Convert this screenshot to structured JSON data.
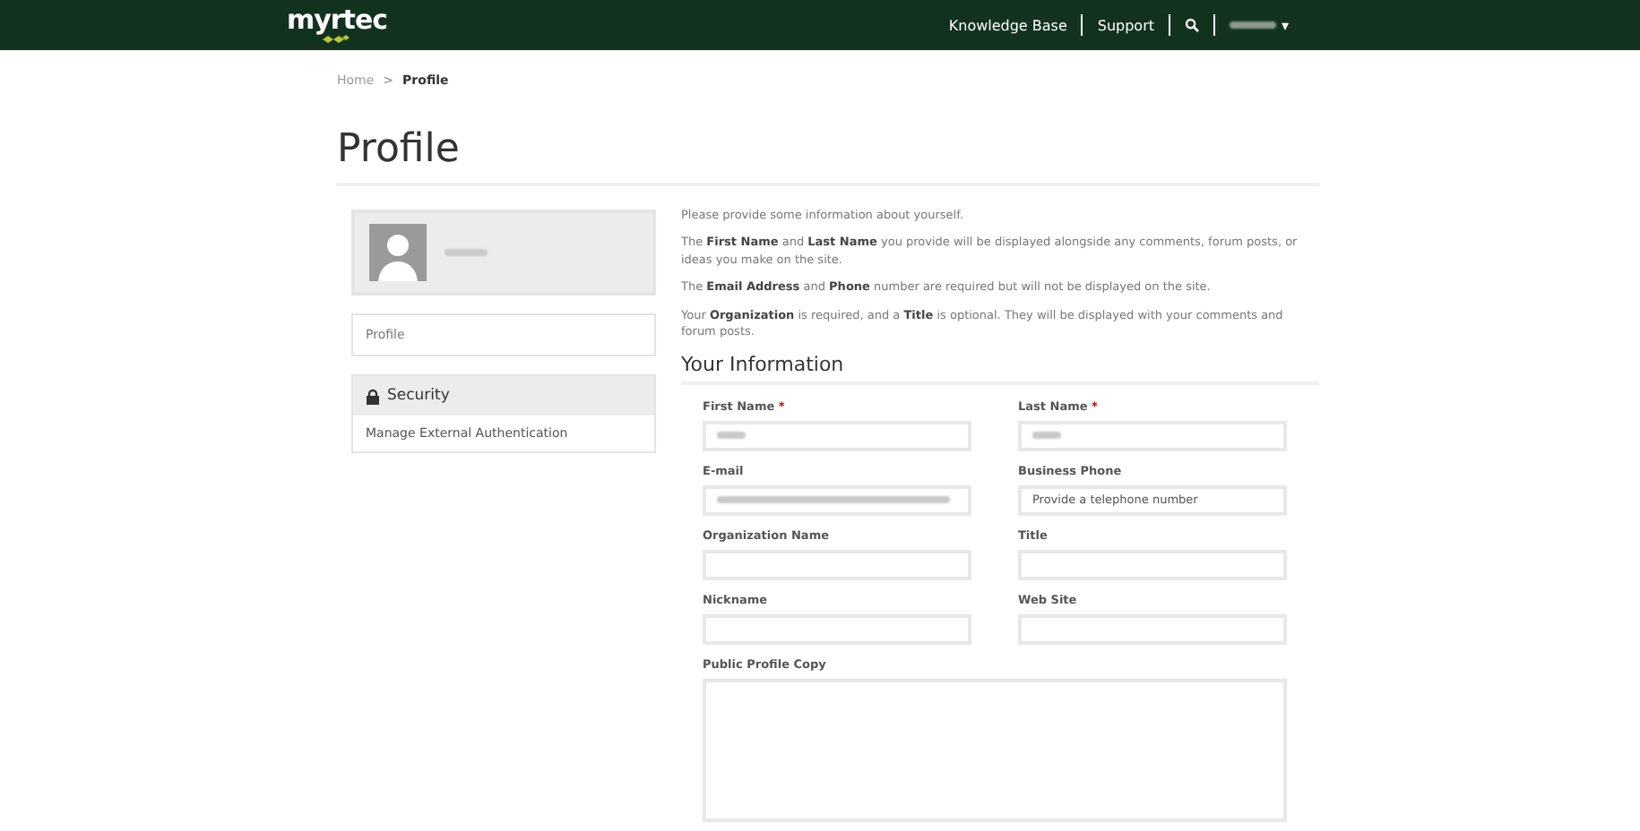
{
  "navbar": {
    "logo": "myrtec",
    "links": [
      "Knowledge Base",
      "Support"
    ],
    "user_menu": {
      "caret": "▾"
    }
  },
  "breadcrumb": [
    {
      "label": "Home",
      "current": false
    },
    {
      "label": "Profile",
      "current": true
    }
  ],
  "breadcrumb_separator": ">",
  "page_title": "Profile",
  "sidebar": {
    "nav": [
      {
        "label": "Profile",
        "selected": false
      }
    ],
    "security": {
      "title": "Security",
      "items": [
        "Manage External Authentication"
      ]
    }
  },
  "intro": [
    "Please provide some information about yourself.",
    "The **First Name** and **Last Name** you provide will be displayed alongside any comments, forum posts, or ideas you make on the site.",
    "The **Email Address** and **Phone** number are required but will not be displayed on the site.",
    "Your **Organization** is required, and a **Title** is optional. They will be displayed with your comments and forum posts."
  ],
  "section_title": "Your Information",
  "required_mark": "*",
  "fields": [
    {
      "label": "First Name",
      "required": true,
      "redacted": true
    },
    {
      "label": "Last Name",
      "required": true,
      "redacted": true
    },
    {
      "label": "E-mail",
      "required": false,
      "redacted": true
    },
    {
      "label": "Business Phone",
      "required": false,
      "redacted": false,
      "placeholder": "Provide a telephone number"
    },
    {
      "label": "Organization Name",
      "required": false,
      "redacted": false
    },
    {
      "label": "Title",
      "required": false,
      "redacted": false
    },
    {
      "label": "Nickname",
      "required": false,
      "redacted": false
    },
    {
      "label": "Web Site",
      "required": false,
      "redacted": false
    }
  ],
  "textarea": {
    "label": "Public Profile Copy"
  }
}
